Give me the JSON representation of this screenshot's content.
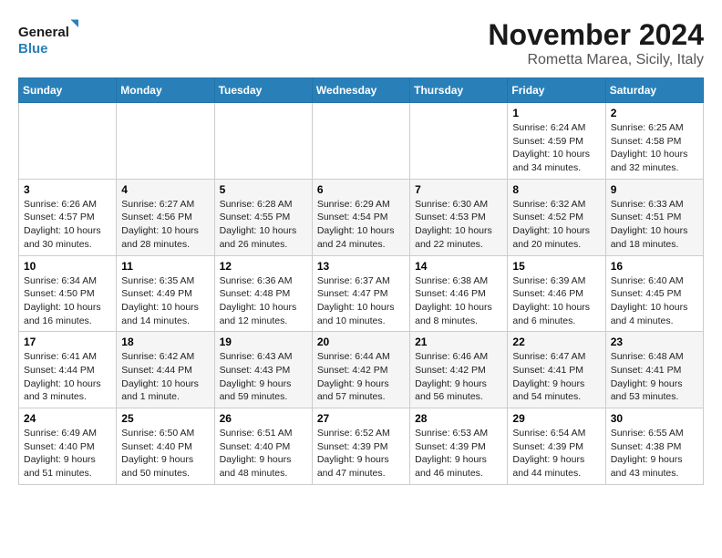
{
  "logo": {
    "line1": "General",
    "line2": "Blue"
  },
  "title": "November 2024",
  "location": "Rometta Marea, Sicily, Italy",
  "weekdays": [
    "Sunday",
    "Monday",
    "Tuesday",
    "Wednesday",
    "Thursday",
    "Friday",
    "Saturday"
  ],
  "weeks": [
    [
      {
        "day": "",
        "info": ""
      },
      {
        "day": "",
        "info": ""
      },
      {
        "day": "",
        "info": ""
      },
      {
        "day": "",
        "info": ""
      },
      {
        "day": "",
        "info": ""
      },
      {
        "day": "1",
        "info": "Sunrise: 6:24 AM\nSunset: 4:59 PM\nDaylight: 10 hours\nand 34 minutes."
      },
      {
        "day": "2",
        "info": "Sunrise: 6:25 AM\nSunset: 4:58 PM\nDaylight: 10 hours\nand 32 minutes."
      }
    ],
    [
      {
        "day": "3",
        "info": "Sunrise: 6:26 AM\nSunset: 4:57 PM\nDaylight: 10 hours\nand 30 minutes."
      },
      {
        "day": "4",
        "info": "Sunrise: 6:27 AM\nSunset: 4:56 PM\nDaylight: 10 hours\nand 28 minutes."
      },
      {
        "day": "5",
        "info": "Sunrise: 6:28 AM\nSunset: 4:55 PM\nDaylight: 10 hours\nand 26 minutes."
      },
      {
        "day": "6",
        "info": "Sunrise: 6:29 AM\nSunset: 4:54 PM\nDaylight: 10 hours\nand 24 minutes."
      },
      {
        "day": "7",
        "info": "Sunrise: 6:30 AM\nSunset: 4:53 PM\nDaylight: 10 hours\nand 22 minutes."
      },
      {
        "day": "8",
        "info": "Sunrise: 6:32 AM\nSunset: 4:52 PM\nDaylight: 10 hours\nand 20 minutes."
      },
      {
        "day": "9",
        "info": "Sunrise: 6:33 AM\nSunset: 4:51 PM\nDaylight: 10 hours\nand 18 minutes."
      }
    ],
    [
      {
        "day": "10",
        "info": "Sunrise: 6:34 AM\nSunset: 4:50 PM\nDaylight: 10 hours\nand 16 minutes."
      },
      {
        "day": "11",
        "info": "Sunrise: 6:35 AM\nSunset: 4:49 PM\nDaylight: 10 hours\nand 14 minutes."
      },
      {
        "day": "12",
        "info": "Sunrise: 6:36 AM\nSunset: 4:48 PM\nDaylight: 10 hours\nand 12 minutes."
      },
      {
        "day": "13",
        "info": "Sunrise: 6:37 AM\nSunset: 4:47 PM\nDaylight: 10 hours\nand 10 minutes."
      },
      {
        "day": "14",
        "info": "Sunrise: 6:38 AM\nSunset: 4:46 PM\nDaylight: 10 hours\nand 8 minutes."
      },
      {
        "day": "15",
        "info": "Sunrise: 6:39 AM\nSunset: 4:46 PM\nDaylight: 10 hours\nand 6 minutes."
      },
      {
        "day": "16",
        "info": "Sunrise: 6:40 AM\nSunset: 4:45 PM\nDaylight: 10 hours\nand 4 minutes."
      }
    ],
    [
      {
        "day": "17",
        "info": "Sunrise: 6:41 AM\nSunset: 4:44 PM\nDaylight: 10 hours\nand 3 minutes."
      },
      {
        "day": "18",
        "info": "Sunrise: 6:42 AM\nSunset: 4:44 PM\nDaylight: 10 hours\nand 1 minute."
      },
      {
        "day": "19",
        "info": "Sunrise: 6:43 AM\nSunset: 4:43 PM\nDaylight: 9 hours\nand 59 minutes."
      },
      {
        "day": "20",
        "info": "Sunrise: 6:44 AM\nSunset: 4:42 PM\nDaylight: 9 hours\nand 57 minutes."
      },
      {
        "day": "21",
        "info": "Sunrise: 6:46 AM\nSunset: 4:42 PM\nDaylight: 9 hours\nand 56 minutes."
      },
      {
        "day": "22",
        "info": "Sunrise: 6:47 AM\nSunset: 4:41 PM\nDaylight: 9 hours\nand 54 minutes."
      },
      {
        "day": "23",
        "info": "Sunrise: 6:48 AM\nSunset: 4:41 PM\nDaylight: 9 hours\nand 53 minutes."
      }
    ],
    [
      {
        "day": "24",
        "info": "Sunrise: 6:49 AM\nSunset: 4:40 PM\nDaylight: 9 hours\nand 51 minutes."
      },
      {
        "day": "25",
        "info": "Sunrise: 6:50 AM\nSunset: 4:40 PM\nDaylight: 9 hours\nand 50 minutes."
      },
      {
        "day": "26",
        "info": "Sunrise: 6:51 AM\nSunset: 4:40 PM\nDaylight: 9 hours\nand 48 minutes."
      },
      {
        "day": "27",
        "info": "Sunrise: 6:52 AM\nSunset: 4:39 PM\nDaylight: 9 hours\nand 47 minutes."
      },
      {
        "day": "28",
        "info": "Sunrise: 6:53 AM\nSunset: 4:39 PM\nDaylight: 9 hours\nand 46 minutes."
      },
      {
        "day": "29",
        "info": "Sunrise: 6:54 AM\nSunset: 4:39 PM\nDaylight: 9 hours\nand 44 minutes."
      },
      {
        "day": "30",
        "info": "Sunrise: 6:55 AM\nSunset: 4:38 PM\nDaylight: 9 hours\nand 43 minutes."
      }
    ]
  ]
}
